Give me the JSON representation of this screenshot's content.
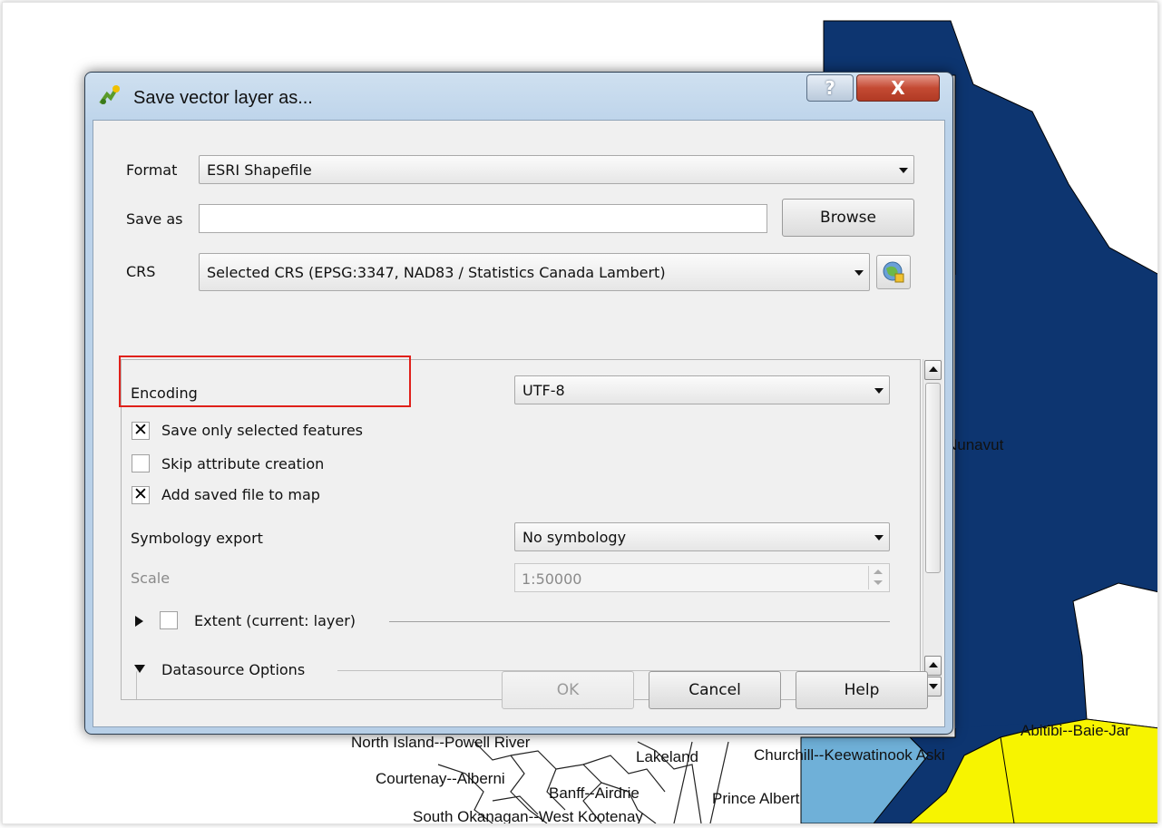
{
  "map": {
    "labels": {
      "nunavut": "Nunavut",
      "abitibi": "Abitibi--Baie-Jar",
      "north_island": "North Island--Powell River",
      "lakeland": "Lakeland",
      "churchill": "Churchill--Keewatinook Aski",
      "courtenay": "Courtenay--Alberni",
      "banff": "Banff--Airdrie",
      "prince_albert": "Prince Albert",
      "south_okanagan": "South Okanagan--West Kootenay"
    },
    "colors": {
      "dark_region": "#0d3570",
      "light_region": "#6fb0d8",
      "yellow_region": "#f7f400"
    }
  },
  "dialog": {
    "title": "Save vector layer as...",
    "help_button": "?",
    "close_button": "X",
    "format_label": "Format",
    "format_value": "ESRI Shapefile",
    "save_as_label": "Save as",
    "save_as_value": "",
    "browse_label": "Browse",
    "crs_label": "CRS",
    "crs_value": "Selected CRS (EPSG:3347, NAD83 / Statistics Canada Lambert)",
    "encoding_label": "Encoding",
    "encoding_value": "UTF-8",
    "save_selected_label": "Save only selected features",
    "save_selected_checked": true,
    "skip_attr_label": "Skip attribute creation",
    "skip_attr_checked": false,
    "add_to_map_label": "Add saved file to map",
    "add_to_map_checked": true,
    "symbology_label": "Symbology export",
    "symbology_value": "No symbology",
    "scale_label": "Scale",
    "scale_value": "1:50000",
    "extent_label": "Extent (current: layer)",
    "datasource_label": "Datasource Options",
    "ok_label": "OK",
    "cancel_label": "Cancel",
    "help_label": "Help",
    "check_mark": "✕"
  }
}
